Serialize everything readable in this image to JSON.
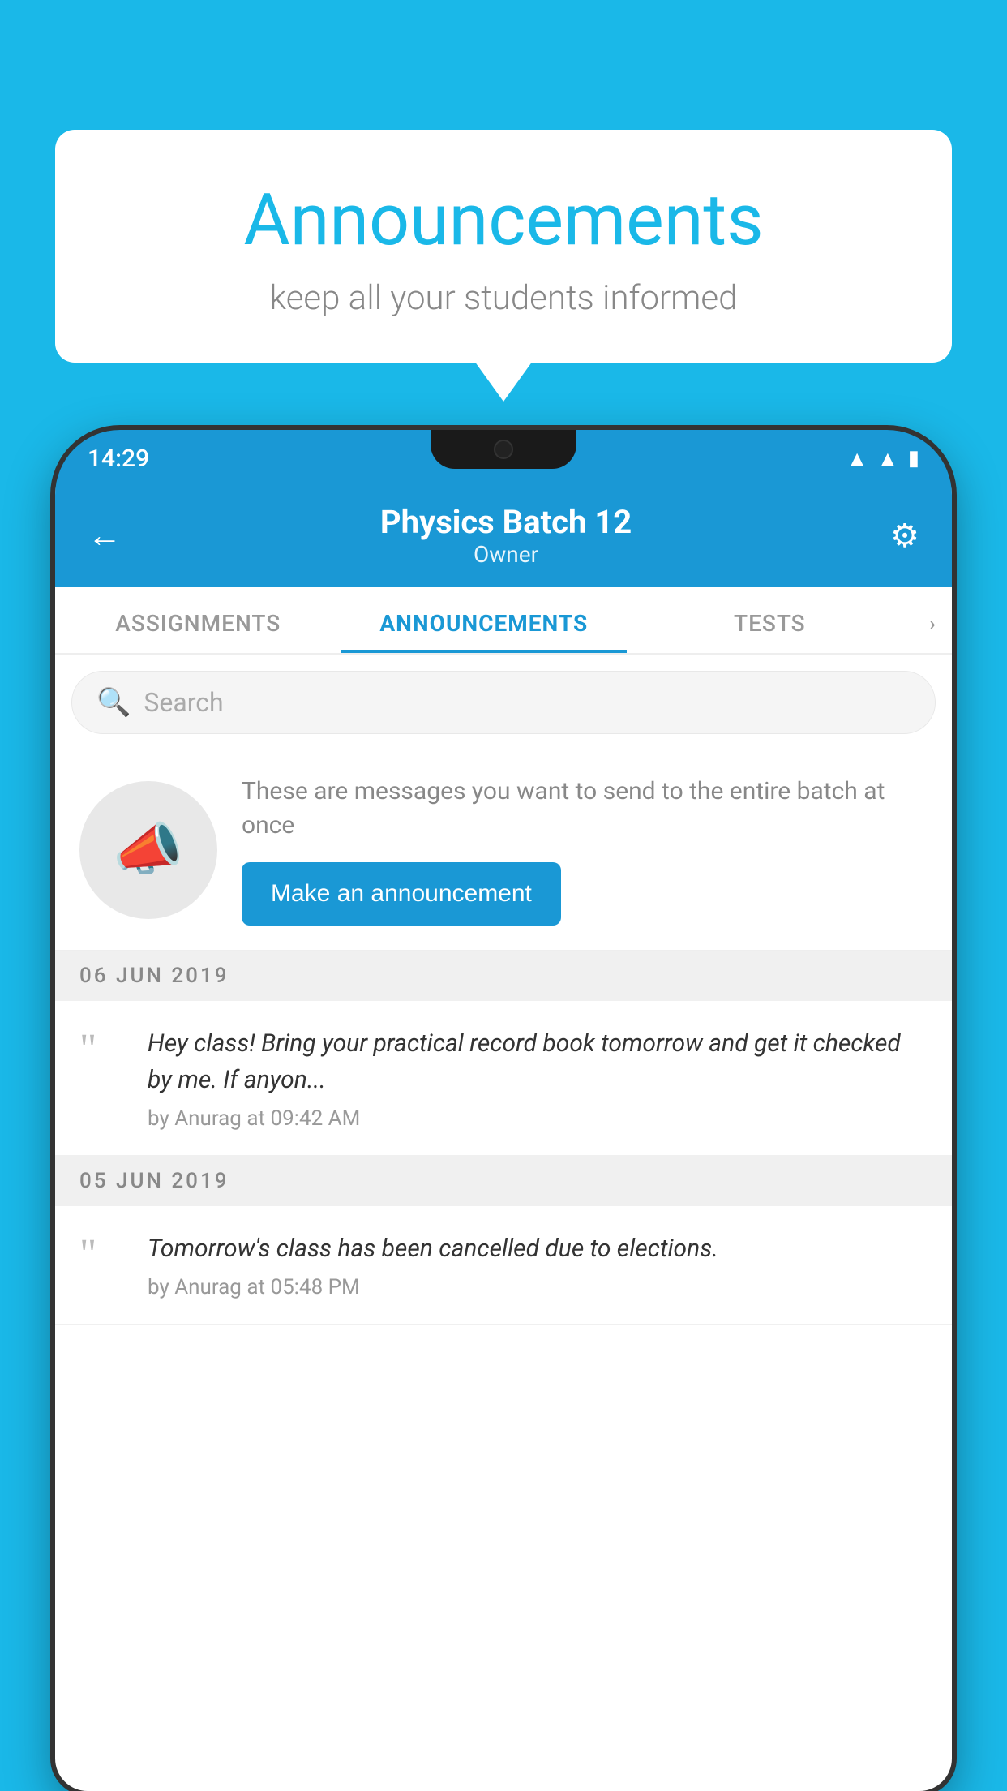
{
  "background_color": "#1ab8e8",
  "speech_bubble": {
    "title": "Announcements",
    "subtitle": "keep all your students informed"
  },
  "phone": {
    "status_bar": {
      "time": "14:29",
      "icons": [
        "wifi",
        "signal",
        "battery"
      ]
    },
    "header": {
      "title": "Physics Batch 12",
      "subtitle": "Owner",
      "back_label": "←",
      "gear_label": "⚙"
    },
    "tabs": [
      {
        "label": "ASSIGNMENTS",
        "active": false
      },
      {
        "label": "ANNOUNCEMENTS",
        "active": true
      },
      {
        "label": "TESTS",
        "active": false
      },
      {
        "label": "›",
        "active": false
      }
    ],
    "search": {
      "placeholder": "Search"
    },
    "promo": {
      "text": "These are messages you want to send to the entire batch at once",
      "button_label": "Make an announcement"
    },
    "announcements": [
      {
        "date": "06  JUN  2019",
        "text": "Hey class! Bring your practical record book tomorrow and get it checked by me. If anyon...",
        "meta": "by Anurag at 09:42 AM"
      },
      {
        "date": "05  JUN  2019",
        "text": "Tomorrow's class has been cancelled due to elections.",
        "meta": "by Anurag at 05:48 PM"
      }
    ]
  }
}
